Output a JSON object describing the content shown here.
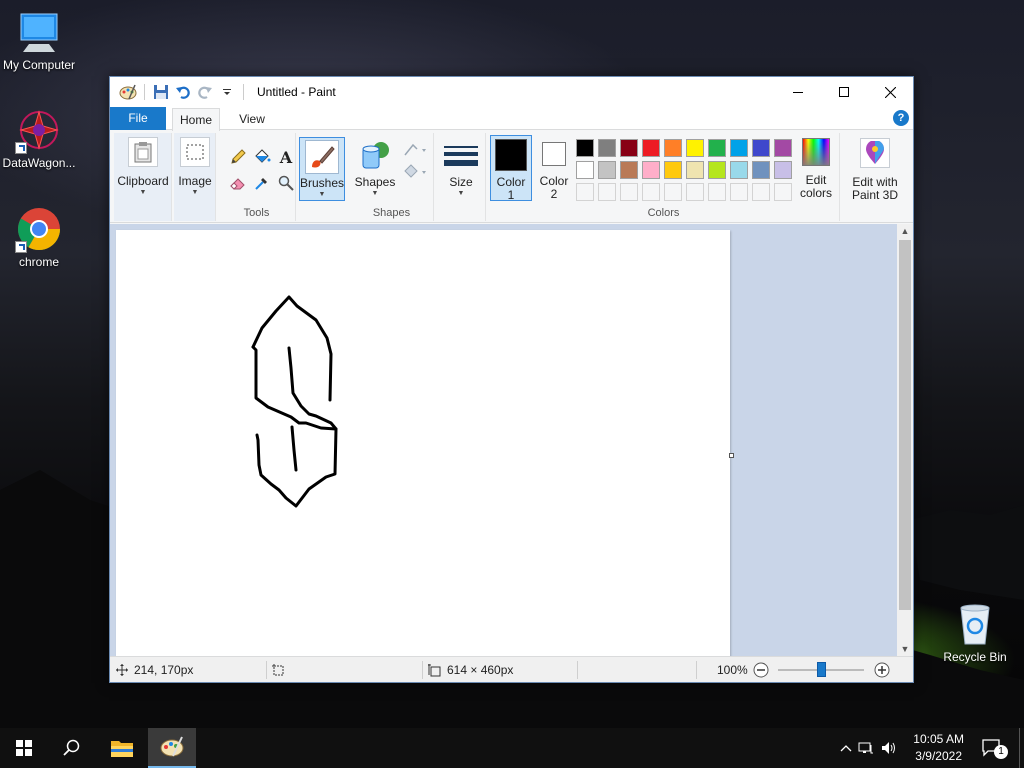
{
  "desktop": {
    "icons": [
      {
        "label": "My Computer",
        "icon": "monitor-icon"
      },
      {
        "label": "DataWagon...",
        "icon": "datawagon-icon"
      },
      {
        "label": "chrome",
        "icon": "chrome-icon"
      },
      {
        "label": "Recycle Bin",
        "icon": "recycle-bin-icon"
      }
    ]
  },
  "window": {
    "title": "Untitled - Paint",
    "tabs": {
      "file": "File",
      "home": "Home",
      "view": "View"
    },
    "help": "?",
    "ribbon": {
      "clipboard": "Clipboard",
      "image": "Image",
      "tools_label": "Tools",
      "brushes": "Brushes",
      "shapes": "Shapes",
      "shapes_label": "Shapes",
      "size": "Size",
      "color1_line1": "Color",
      "color1_line2": "1",
      "color2_line1": "Color",
      "color2_line2": "2",
      "edit_colors_line1": "Edit",
      "edit_colors_line2": "colors",
      "colors_label": "Colors",
      "paint3d_line1": "Edit with",
      "paint3d_line2": "Paint 3D"
    },
    "colors": {
      "color1": "#000000",
      "color2": "#ffffff",
      "row1": [
        "#000000",
        "#7f7f7f",
        "#880015",
        "#ed1c24",
        "#ff7f27",
        "#fff200",
        "#22b14c",
        "#00a2e8",
        "#3f48cc",
        "#a349a4"
      ],
      "row2": [
        "#ffffff",
        "#c3c3c3",
        "#b97a57",
        "#ffaec9",
        "#ffc90e",
        "#efe4b0",
        "#b5e61d",
        "#99d9ea",
        "#7092be",
        "#c8bfe7"
      ]
    },
    "status": {
      "position": "214, 170px",
      "canvas_size": "614 × 460px",
      "zoom": "100%",
      "zoom_fraction": 0.5
    }
  },
  "taskbar": {
    "time": "10:05 AM",
    "date": "3/9/2022",
    "notifications": "1"
  }
}
